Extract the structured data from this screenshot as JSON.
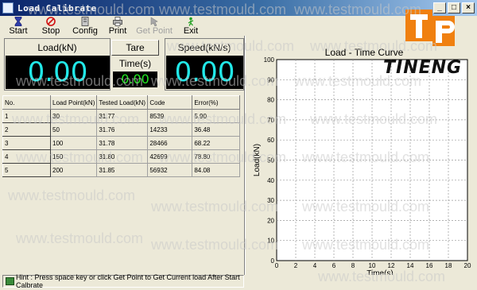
{
  "window": {
    "title": "Load Calibrate",
    "controls": [
      "_",
      "□",
      "×"
    ]
  },
  "toolbar": [
    {
      "label": "Start",
      "icon": "hourglass-icon",
      "enabled": true
    },
    {
      "label": "Stop",
      "icon": "stop-icon",
      "enabled": true
    },
    {
      "label": "Config",
      "icon": "config-icon",
      "enabled": true
    },
    {
      "label": "Print",
      "icon": "printer-icon",
      "enabled": true
    },
    {
      "label": "Get Point",
      "icon": "get-point-icon",
      "enabled": false
    },
    {
      "label": "Exit",
      "icon": "exit-icon",
      "enabled": true
    }
  ],
  "panels": {
    "load": {
      "title": "Load(kN)",
      "value": "0.00"
    },
    "tare": {
      "label": "Tare"
    },
    "time": {
      "title": "Time(s)",
      "value": "0.00"
    },
    "speed": {
      "title": "Speed(kN/s)",
      "value": "0.00"
    }
  },
  "table": {
    "headers": [
      "No.",
      "Load Point(kN)",
      "Tested Load(kN)",
      "Code",
      "Error(%)"
    ],
    "rows": [
      [
        "1",
        "30",
        "31.77",
        "8539",
        "5.90"
      ],
      [
        "2",
        "50",
        "31.76",
        "14233",
        "36.48"
      ],
      [
        "3",
        "100",
        "31.78",
        "28466",
        "68.22"
      ],
      [
        "4",
        "150",
        "31.80",
        "42699",
        "78.80"
      ],
      [
        "5",
        "200",
        "31.85",
        "56932",
        "84.08"
      ]
    ]
  },
  "status": {
    "hint": "Hint :  Press space key or click Get Point to Get Current load After Start Calbrate"
  },
  "watermark": "www.testmould.com",
  "logo": {
    "brand": "TINENG",
    "mark": "TP"
  },
  "chart_data": {
    "type": "line",
    "title": "Load - Time Curve",
    "xlabel": "Time(s)",
    "ylabel": "Load(kN)",
    "xlim": [
      0,
      20
    ],
    "ylim": [
      0,
      100
    ],
    "xticks": [
      0,
      2,
      4,
      6,
      8,
      10,
      12,
      14,
      16,
      18,
      20
    ],
    "yticks": [
      0,
      10,
      20,
      30,
      40,
      50,
      60,
      70,
      80,
      90,
      100
    ],
    "grid": true,
    "series": []
  },
  "colors": {
    "lcd_cyan": "#21e8e8",
    "lcd_green": "#21e821",
    "window_bg": "#ece9d8",
    "titlebar": "#0a246a"
  }
}
